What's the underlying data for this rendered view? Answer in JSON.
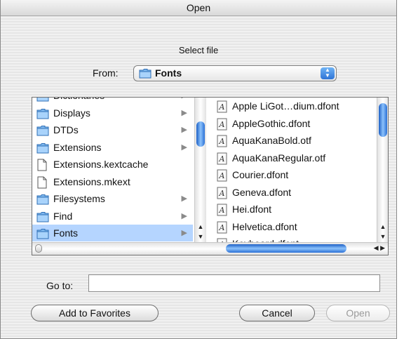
{
  "window": {
    "title": "Open"
  },
  "dialog": {
    "subtitle": "Select file",
    "from_label": "From:",
    "from_value": "Fonts",
    "goto_label": "Go to:",
    "goto_value": ""
  },
  "browser": {
    "left_column": [
      {
        "name": "Dictionaries",
        "kind": "folder",
        "has_children": true,
        "selected": false
      },
      {
        "name": "Displays",
        "kind": "folder",
        "has_children": true,
        "selected": false
      },
      {
        "name": "DTDs",
        "kind": "folder",
        "has_children": true,
        "selected": false
      },
      {
        "name": "Extensions",
        "kind": "folder",
        "has_children": true,
        "selected": false
      },
      {
        "name": "Extensions.kextcache",
        "kind": "file",
        "has_children": false,
        "selected": false
      },
      {
        "name": "Extensions.mkext",
        "kind": "file",
        "has_children": false,
        "selected": false
      },
      {
        "name": "Filesystems",
        "kind": "folder",
        "has_children": true,
        "selected": false
      },
      {
        "name": "Find",
        "kind": "folder",
        "has_children": true,
        "selected": false
      },
      {
        "name": "Fonts",
        "kind": "folder",
        "has_children": true,
        "selected": true
      }
    ],
    "right_column": [
      {
        "name": "Apple LiGot…dium.dfont",
        "kind": "font"
      },
      {
        "name": "AppleGothic.dfont",
        "kind": "font"
      },
      {
        "name": "AquaKanaBold.otf",
        "kind": "font"
      },
      {
        "name": "AquaKanaRegular.otf",
        "kind": "font"
      },
      {
        "name": "Courier.dfont",
        "kind": "font"
      },
      {
        "name": "Geneva.dfont",
        "kind": "font"
      },
      {
        "name": "Hei.dfont",
        "kind": "font"
      },
      {
        "name": "Helvetica.dfont",
        "kind": "font"
      },
      {
        "name": "Keyboard.dfont",
        "kind": "font"
      }
    ]
  },
  "buttons": {
    "add_to_favorites": "Add to Favorites",
    "cancel": "Cancel",
    "open": "Open"
  },
  "colors": {
    "selection": "#b5d5ff",
    "aqua_blue": "#2f74d6"
  },
  "icons": {
    "folder": "folder-icon",
    "file": "document-icon",
    "font": "font-file-icon",
    "popup": "popup-arrows-icon"
  }
}
